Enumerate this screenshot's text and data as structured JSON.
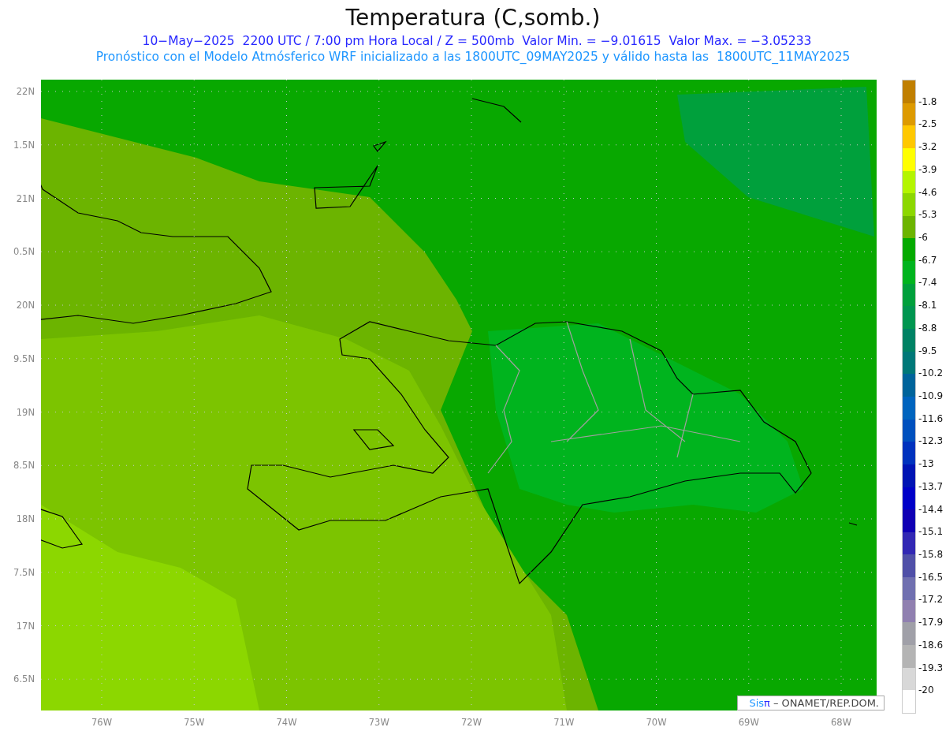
{
  "title": "Temperatura (C,somb.)",
  "subtitle": "10−May−2025  2200 UTC / 7:00 pm Hora Local / Z = 500mb  Valor Min. = −9.01615  Valor Max. = −3.05233",
  "forecast_note": "Pronóstico con el Modelo Atmósferico WRF inicializado a las 1800UTC_09MAY2025 y válido hasta las  1800UTC_11MAY2025",
  "y_axis_labels": [
    "22N",
    "1.5N",
    "21N",
    "0.5N",
    "20N",
    "9.5N",
    "19N",
    "8.5N",
    "18N",
    "7.5N",
    "17N",
    "6.5N"
  ],
  "x_axis_labels": [
    "76W",
    "75W",
    "74W",
    "73W",
    "72W",
    "71W",
    "70W",
    "69W",
    "68W"
  ],
  "credit": {
    "logo_sis": "Sis",
    "logo_pi": "π",
    "text": "– ONAMET/REP.DOM."
  },
  "legend": {
    "swatches": [
      {
        "color": "#c07f00"
      },
      {
        "color": "#dd9a00"
      },
      {
        "color": "#ffc800"
      },
      {
        "color": "#ffff00"
      },
      {
        "color": "#b4f500"
      },
      {
        "color": "#8cd700"
      },
      {
        "color": "#6cb400"
      },
      {
        "color": "#04aa00"
      },
      {
        "color": "#00b41e"
      },
      {
        "color": "#00a03c"
      },
      {
        "color": "#009650"
      },
      {
        "color": "#008264"
      },
      {
        "color": "#007878"
      },
      {
        "color": "#00649b"
      },
      {
        "color": "#0064be"
      },
      {
        "color": "#0050be"
      },
      {
        "color": "#0032be"
      },
      {
        "color": "#0014b4"
      },
      {
        "color": "#0000c8"
      },
      {
        "color": "#1000b4"
      },
      {
        "color": "#3228b4"
      },
      {
        "color": "#5050a8"
      },
      {
        "color": "#7070b0"
      },
      {
        "color": "#9080b0"
      },
      {
        "color": "#a0a0a8"
      },
      {
        "color": "#b4b4b4"
      },
      {
        "color": "#d8d8d8"
      },
      {
        "color": "#ffffff"
      }
    ],
    "labels": [
      "-1.8",
      "-2.5",
      "-3.2",
      "-3.9",
      "-4.6",
      "-5.3",
      "-6",
      "-6.7",
      "-7.4",
      "-8.1",
      "-8.8",
      "-9.5",
      "-10.2",
      "-10.9",
      "-11.6",
      "-12.3",
      "-13",
      "-13.7",
      "-14.4",
      "-15.1",
      "-15.8",
      "-16.5",
      "-17.2",
      "-17.9",
      "-18.6",
      "-19.3",
      "-20"
    ]
  }
}
